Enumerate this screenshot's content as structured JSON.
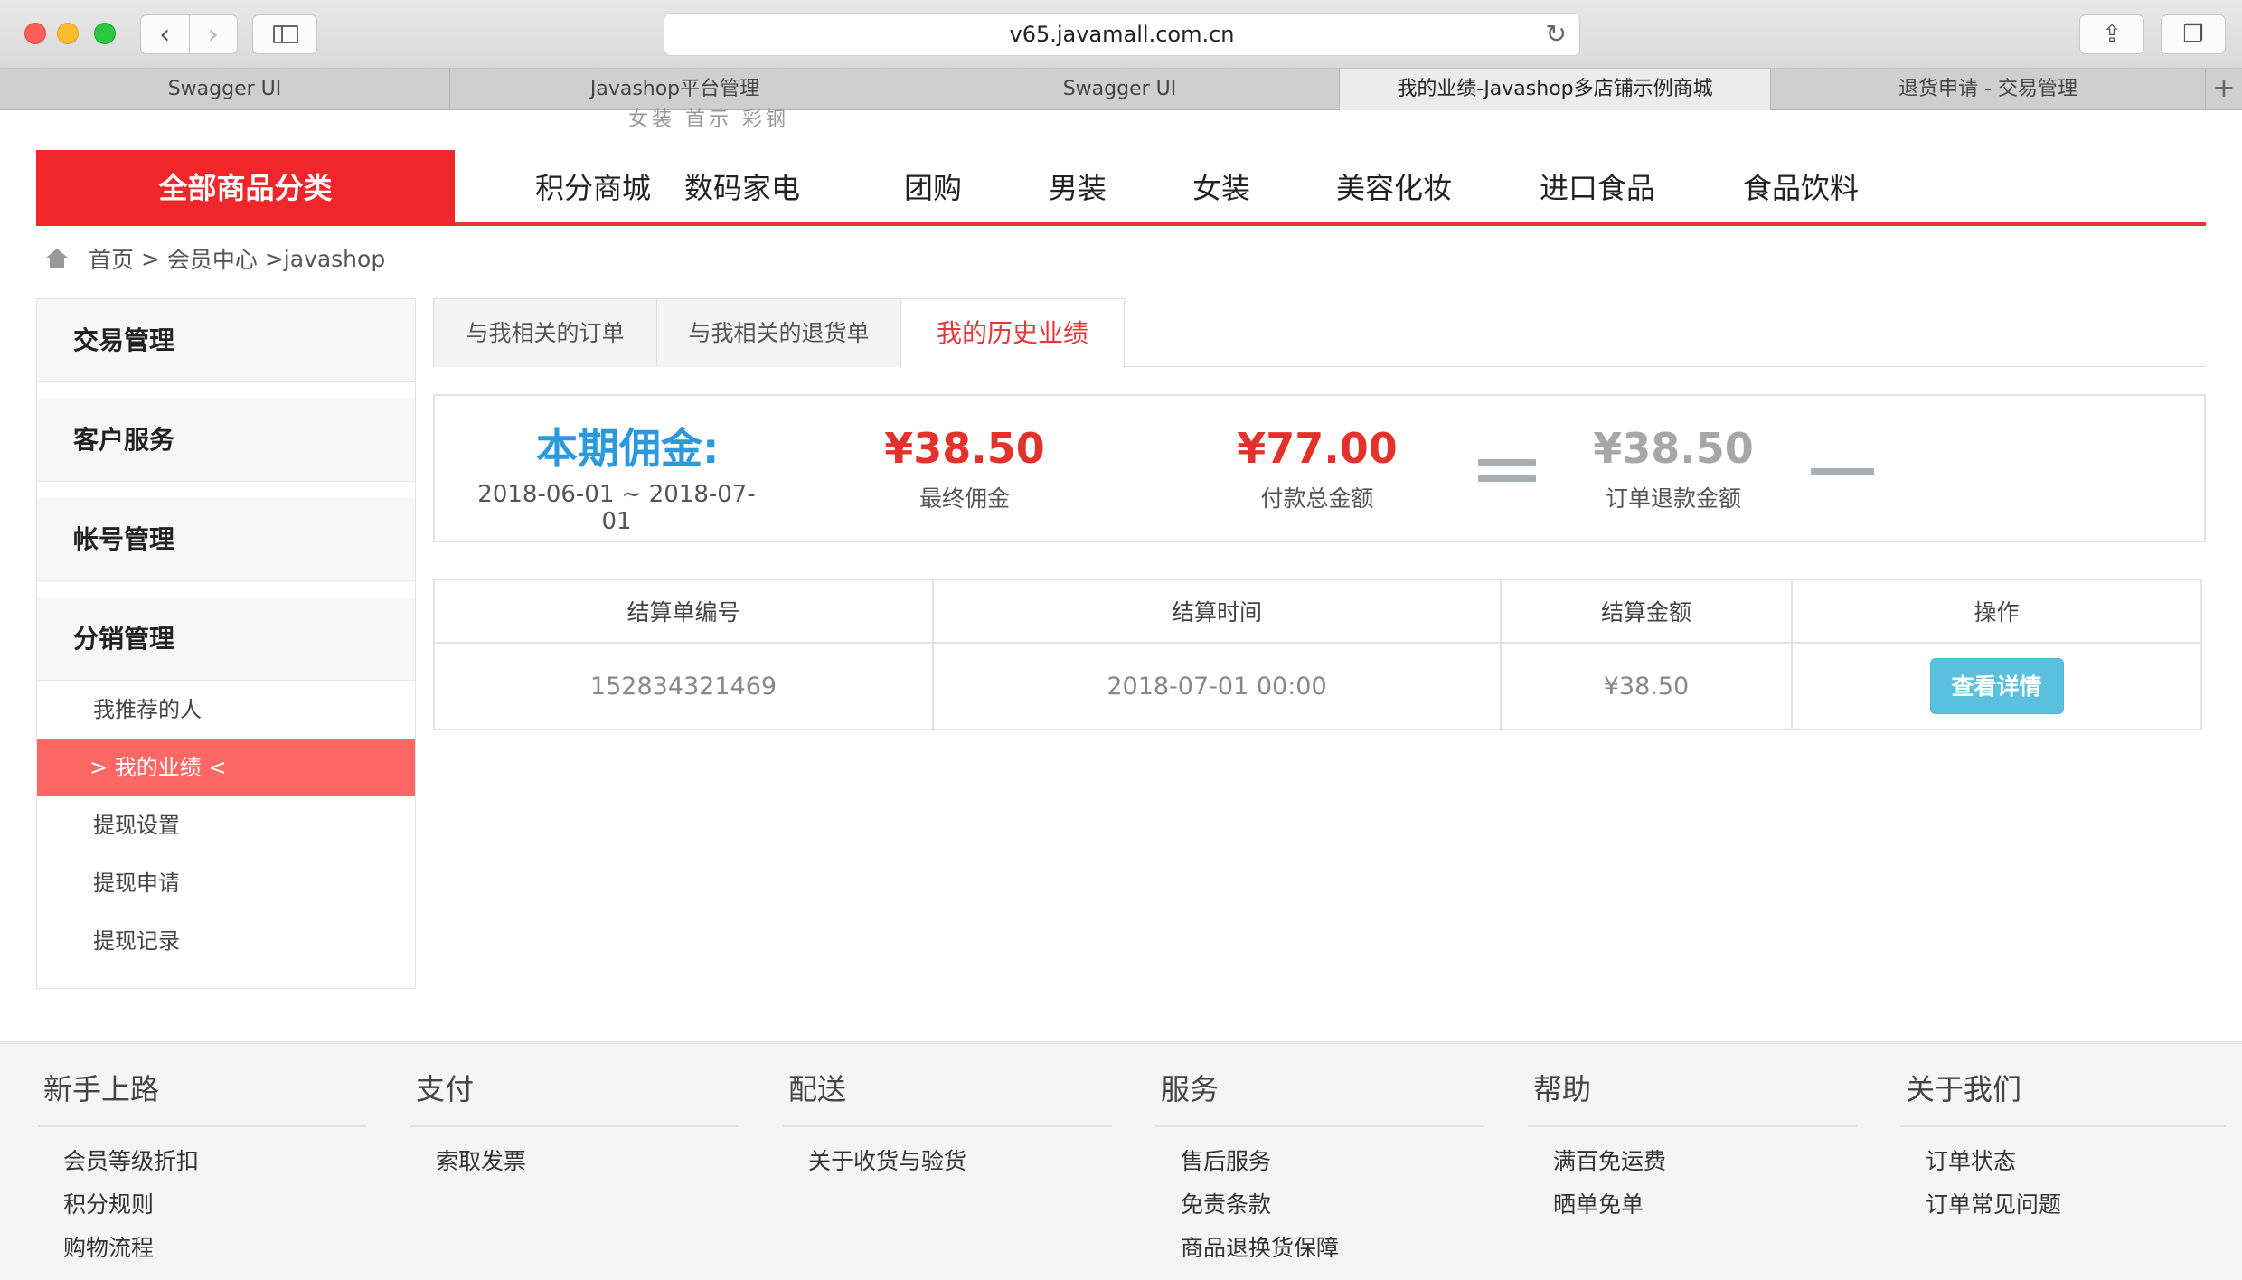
{
  "browser": {
    "url": "v65.javamall.com.cn",
    "tabs": [
      {
        "label": "Swagger UI",
        "active": false
      },
      {
        "label": "Javashop平台管理",
        "active": false
      },
      {
        "label": "Swagger UI",
        "active": false
      },
      {
        "label": "我的业绩-Javashop多店铺示例商城",
        "active": true
      },
      {
        "label": "退货申请 - 交易管理",
        "active": false
      }
    ],
    "icons": {
      "back": "chevron-left-icon",
      "forward": "chevron-right-icon",
      "sidebar": "sidebar-icon",
      "reload": "reload-icon",
      "share": "share-icon",
      "tabs": "tabs-overview-icon",
      "new_tab": "plus-icon"
    }
  },
  "header": {
    "cut_text": "女装 首示 彩钢",
    "all_categories": "全部商品分类",
    "categories": [
      "积分商城",
      "数码家电",
      "团购",
      "男装",
      "女装",
      "美容化妆",
      "进口食品",
      "食品饮料"
    ]
  },
  "breadcrumb": {
    "icon": "home-icon",
    "home": "首页",
    "sep1": " > ",
    "member": "会员中心",
    "sep2": " >",
    "current": "javashop"
  },
  "sidebar": {
    "sections": [
      {
        "label": "交易管理"
      },
      {
        "label": "客户服务"
      },
      {
        "label": "帐号管理"
      },
      {
        "label": "分销管理"
      }
    ],
    "items": [
      {
        "label": "我推荐的人",
        "active": false
      },
      {
        "label": "> 我的业绩 <",
        "active": true
      },
      {
        "label": "提现设置",
        "active": false
      },
      {
        "label": "提现申请",
        "active": false
      },
      {
        "label": "提现记录",
        "active": false
      }
    ]
  },
  "content_tabs": [
    {
      "label": "与我相关的订单",
      "active": false
    },
    {
      "label": "与我相关的退货单",
      "active": false
    },
    {
      "label": "我的历史业绩",
      "active": true
    }
  ],
  "summary": {
    "title": "本期佣金:",
    "period": "2018-06-01 ~ 2018-07-01",
    "final_amount": "¥38.50",
    "final_label": "最终佣金",
    "paid_amount": "¥77.00",
    "paid_label": "付款总金额",
    "refund_amount": "¥38.50",
    "refund_label": "订单退款金额",
    "colors": {
      "title": "#2b99dc",
      "amount": "#e2322b",
      "refund": "#a7a7a7"
    }
  },
  "table": {
    "headers": [
      "结算单编号",
      "结算时间",
      "结算金额",
      "操作"
    ],
    "rows": [
      {
        "id": "152834321469",
        "time": "2018-07-01 00:00",
        "amount": "¥38.50",
        "action": "查看详情"
      }
    ]
  },
  "footer": {
    "columns": [
      {
        "title": "新手上路",
        "items": [
          "会员等级折扣",
          "积分规则",
          "购物流程"
        ]
      },
      {
        "title": "支付",
        "items": [
          "索取发票"
        ]
      },
      {
        "title": "配送",
        "items": [
          "关于收货与验货"
        ]
      },
      {
        "title": "服务",
        "items": [
          "售后服务",
          "免责条款",
          "商品退换货保障"
        ]
      },
      {
        "title": "帮助",
        "items": [
          "满百免运费",
          "晒单免单"
        ]
      },
      {
        "title": "关于我们",
        "items": [
          "订单状态",
          "订单常见问题"
        ]
      }
    ]
  },
  "colors": {
    "brand": "#f0262b",
    "active_menu": "#fb6865",
    "button": "#5bc0de"
  }
}
